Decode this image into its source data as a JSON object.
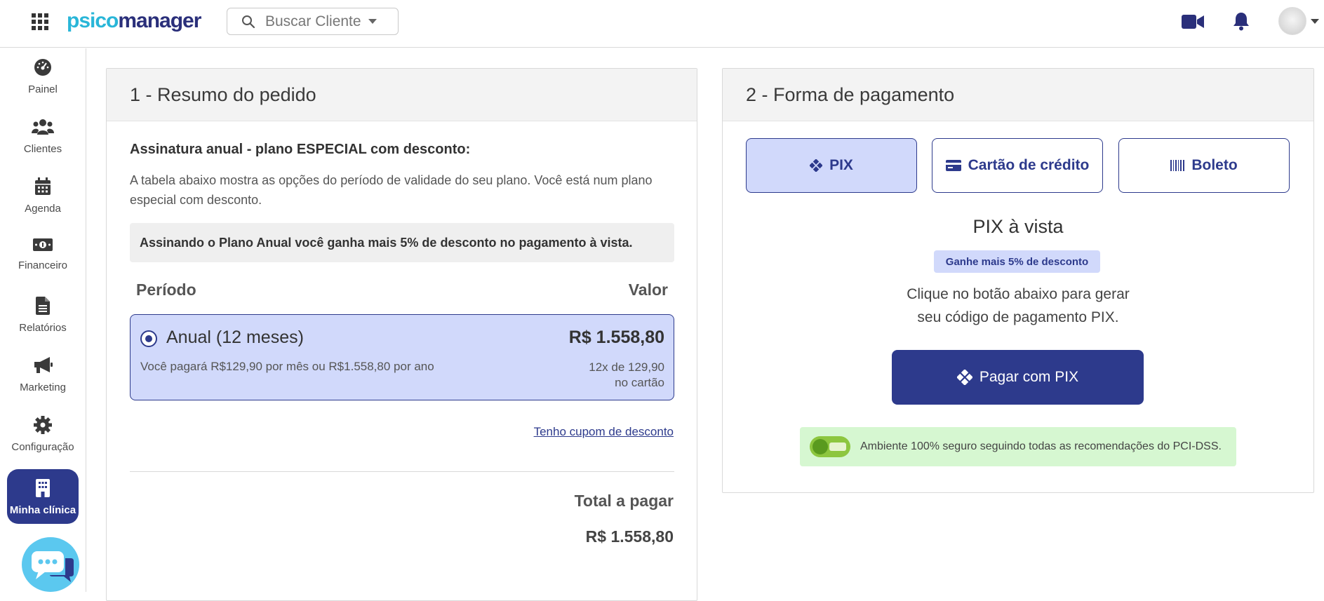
{
  "header": {
    "logo_part1": "psico",
    "logo_part2": "manager",
    "search_placeholder": "Buscar Cliente"
  },
  "sidebar": {
    "items": [
      {
        "label": "Painel",
        "icon": "gauge-icon"
      },
      {
        "label": "Clientes",
        "icon": "users-icon"
      },
      {
        "label": "Agenda",
        "icon": "calendar-icon"
      },
      {
        "label": "Financeiro",
        "icon": "money-icon"
      },
      {
        "label": "Relatórios",
        "icon": "file-icon"
      },
      {
        "label": "Marketing",
        "icon": "megaphone-icon"
      },
      {
        "label": "Configuração",
        "icon": "gear-icon"
      },
      {
        "label": "Minha clínica",
        "icon": "building-icon",
        "active": true
      }
    ]
  },
  "order": {
    "title": "1 - Resumo do pedido",
    "subtitle": "Assinatura anual - plano ESPECIAL com desconto:",
    "description": "A tabela abaixo mostra as opções do período de validade do seu plano. Você está num plano especial com desconto.",
    "promo": "Assinando o Plano Anual você ganha mais 5% de desconto no pagamento à vista.",
    "col_period": "Período",
    "col_value": "Valor",
    "plan": {
      "name": "Anual (12 meses)",
      "price": "R$ 1.558,80",
      "subtext": "Você pagará R$129,90 por mês ou R$1.558,80 por ano",
      "installments_line1": "12x de 129,90",
      "installments_line2": "no cartão"
    },
    "coupon_link": "Tenho cupom de desconto",
    "total_label": "Total a pagar",
    "total_value": "R$ 1.558,80"
  },
  "payment": {
    "title": "2 - Forma de pagamento",
    "options": [
      {
        "label": "PIX",
        "active": true
      },
      {
        "label": "Cartão de crédito",
        "active": false
      },
      {
        "label": "Boleto",
        "active": false
      }
    ],
    "pix_title": "PIX à vista",
    "pix_badge": "Ganhe mais 5% de desconto",
    "pix_desc_line1": "Clique no botão abaixo para gerar",
    "pix_desc_line2": "seu código de pagamento PIX.",
    "pix_button": "Pagar com PIX",
    "secure_text": "Ambiente 100% seguro seguindo todas as recomendações do PCI-DSS."
  },
  "colors": {
    "primary": "#2d3a8c",
    "selected_bg": "#d1d9fb",
    "secure_bg": "#d6f7d1",
    "logo_cyan": "#29b6d8"
  }
}
